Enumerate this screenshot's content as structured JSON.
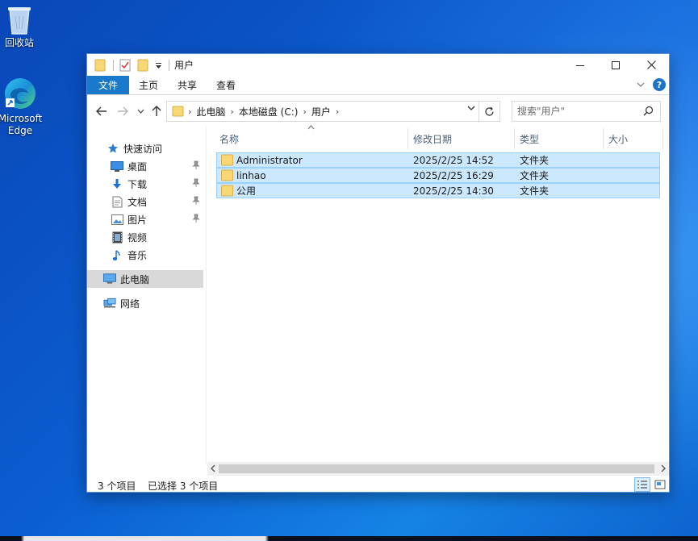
{
  "desktop": {
    "icons": [
      {
        "label": "回收站"
      },
      {
        "label": "Microsoft\nEdge"
      }
    ]
  },
  "window": {
    "title": "用户",
    "ribbon_tabs": [
      "文件",
      "主页",
      "共享",
      "查看"
    ],
    "breadcrumbs": [
      "此电脑",
      "本地磁盘 (C:)",
      "用户"
    ],
    "search_placeholder": "搜索\"用户\"",
    "nav": {
      "quick_access": "快速访问",
      "quick_items": [
        "桌面",
        "下载",
        "文档",
        "图片",
        "视频",
        "音乐"
      ],
      "this_pc": "此电脑",
      "network": "网络"
    },
    "columns": [
      "名称",
      "修改日期",
      "类型",
      "大小"
    ],
    "rows": [
      {
        "name": "Administrator",
        "date": "2025/2/25 14:52",
        "type": "文件夹"
      },
      {
        "name": "linhao",
        "date": "2025/2/25 16:29",
        "type": "文件夹"
      },
      {
        "name": "公用",
        "date": "2025/2/25 14:30",
        "type": "文件夹"
      }
    ],
    "status": {
      "count": "3 个项目",
      "selected": "已选择 3 个项目"
    }
  },
  "colors": {
    "accent": "#1979ca",
    "selection": "#cce8ff",
    "folder": "#f8d775"
  }
}
